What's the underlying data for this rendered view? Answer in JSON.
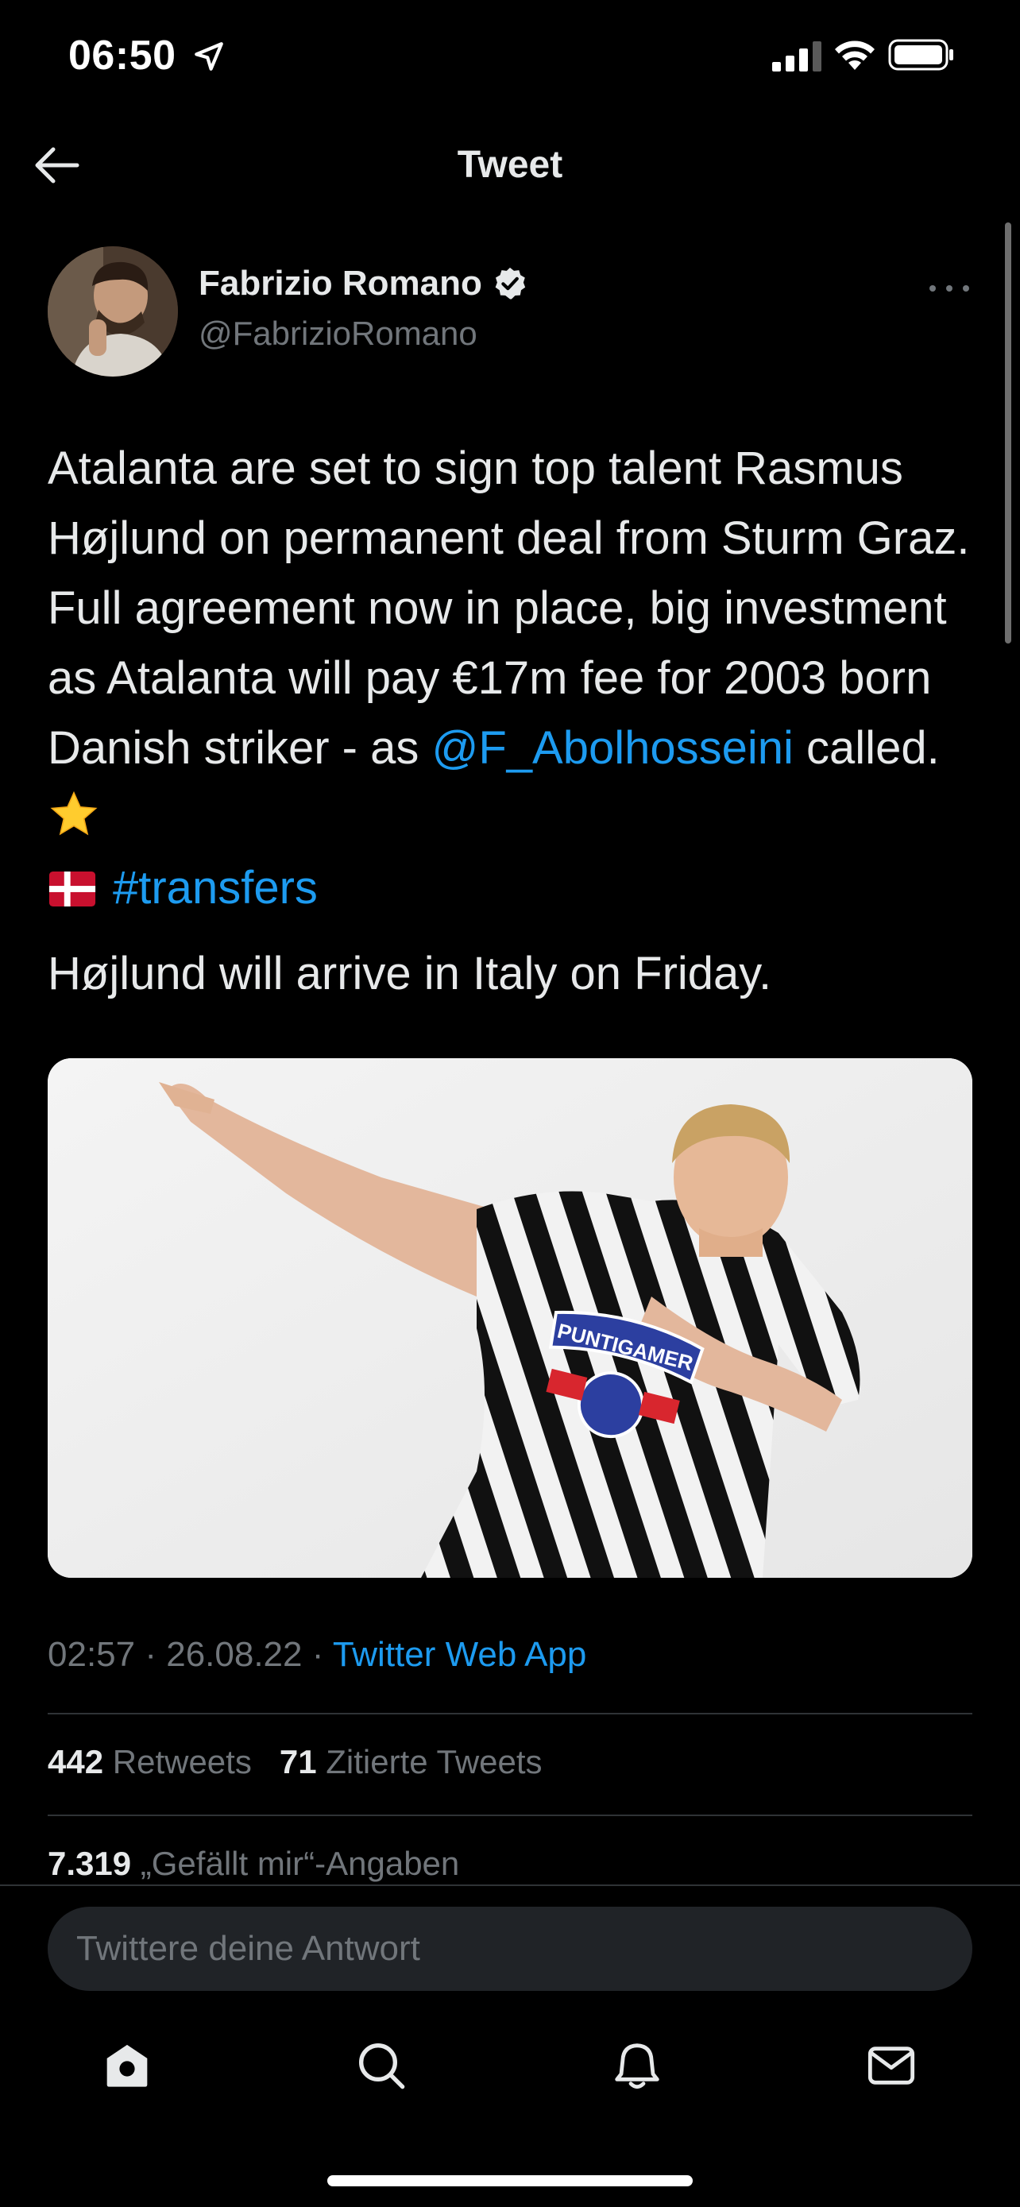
{
  "status_bar": {
    "time": "06:50"
  },
  "header": {
    "title": "Tweet"
  },
  "author": {
    "name": "Fabrizio Romano",
    "handle": "@FabrizioRomano",
    "verified": true
  },
  "tweet": {
    "text_part1": "Atalanta are set to sign top talent Rasmus Højlund on permanent deal from Sturm Graz. Full agreement now in place, big investment as Atalanta will pay €17m fee for 2003 born Danish striker - as ",
    "mention": "@F_Abolhosseini",
    "text_part2": " called. ",
    "hashtag": "#transfers",
    "second_paragraph": "Højlund will arrive in Italy on Friday.",
    "image_sponsor_text": "PUNTIGAMER"
  },
  "meta": {
    "time": "02:57",
    "separator": " · ",
    "date": "26.08.22",
    "app": "Twitter Web App"
  },
  "stats": {
    "retweets_count": "442",
    "retweets_label": "Retweets",
    "quotes_count": "71",
    "quotes_label": "Zitierte Tweets",
    "likes_count": "7.319",
    "likes_label": "„Gefällt mir“-Angaben"
  },
  "reply": {
    "placeholder": "Twittere deine Antwort"
  },
  "tabs": [
    "home-icon",
    "search-icon",
    "notifications-icon",
    "messages-icon"
  ],
  "colors": {
    "accent": "#1d9bf0",
    "background": "#000000",
    "secondary_text": "#71767b"
  }
}
